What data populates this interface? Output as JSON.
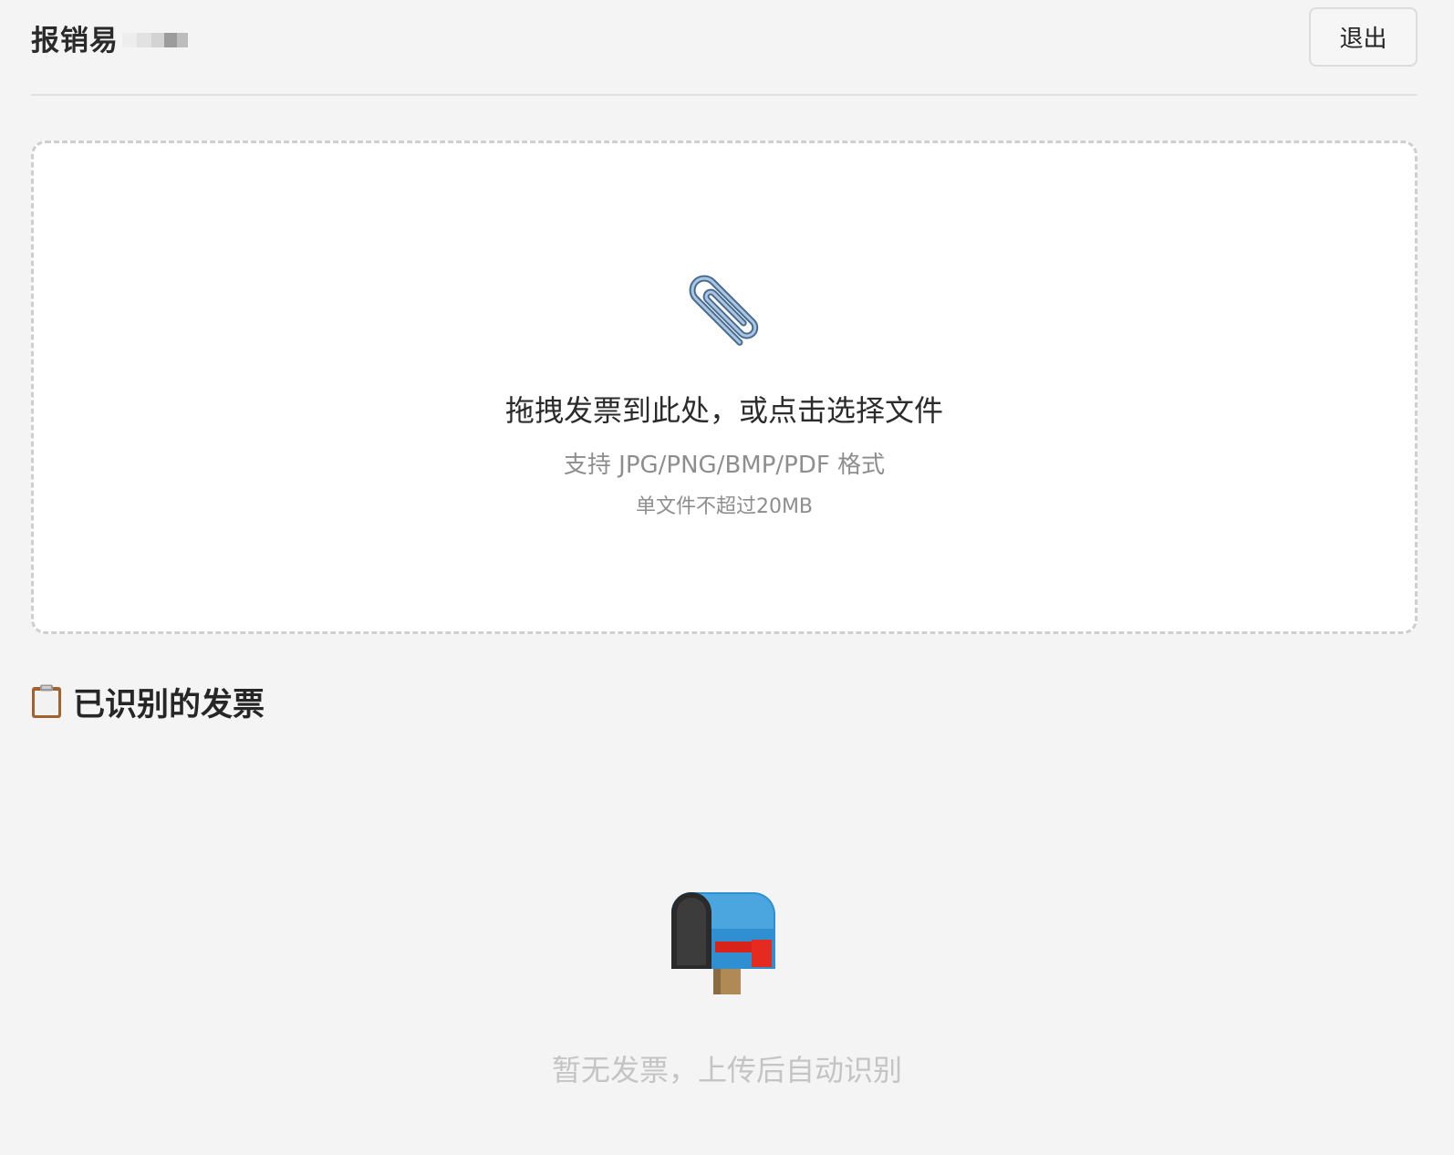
{
  "header": {
    "brand_name": "报销易",
    "logout_label": "退出"
  },
  "upload": {
    "title": "拖拽发票到此处，或点击选择文件",
    "formats": "支持 JPG/PNG/BMP/PDF 格式",
    "size_limit": "单文件不超过20MB",
    "icon": "paperclip-icon"
  },
  "invoices": {
    "section_title": "已识别的发票",
    "section_icon": "clipboard-icon",
    "empty_icon": "mailbox-icon",
    "empty_text": "暂无发票，上传后自动识别"
  }
}
